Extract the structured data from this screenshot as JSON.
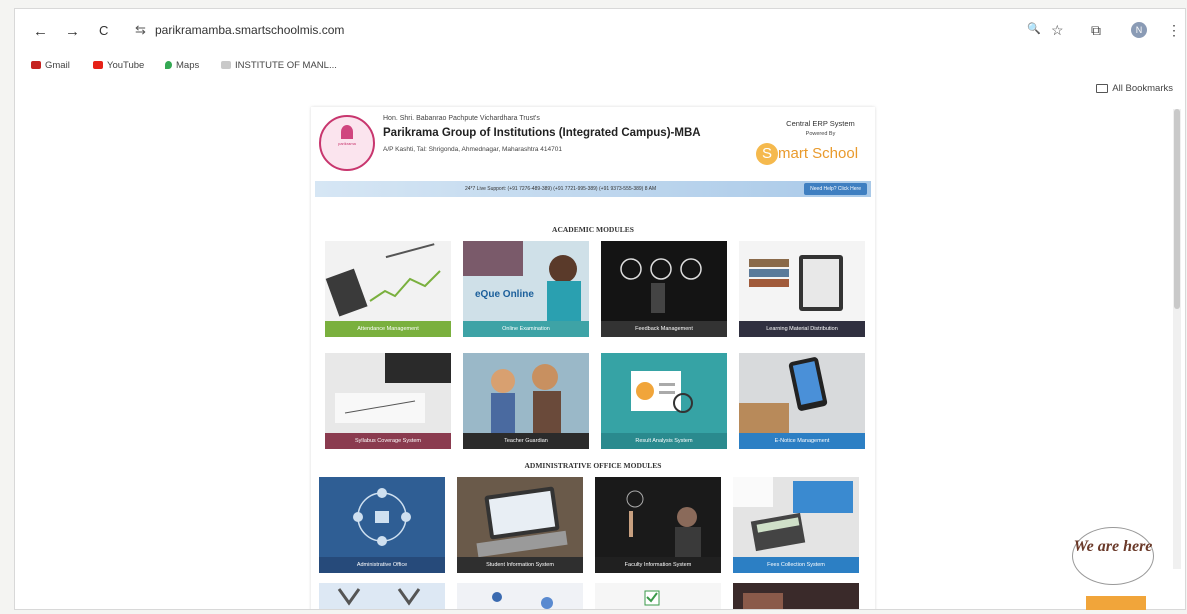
{
  "browser": {
    "url": "parikramamba.smartschoolmis.com",
    "nav_back": "←",
    "nav_forward": "→",
    "nav_reload": "C",
    "site_info": "⇆",
    "zoom_icon": "🔍",
    "star_icon": "☆",
    "extensions_icon": "⧉",
    "profile_letter": "N",
    "menu_icon": "⋮",
    "bookmarks": [
      {
        "label": "Gmail",
        "color": "#c5221f"
      },
      {
        "label": "YouTube",
        "color": "#e62117"
      },
      {
        "label": "Maps",
        "color": "#34a853"
      },
      {
        "label": "INSTITUTE OF MANL...",
        "color": "#9a9a9a"
      }
    ],
    "all_bookmarks": "All Bookmarks"
  },
  "header": {
    "trust": "Hon. Shri. Babanrao Pachpute Vichardhara Trust's",
    "institution": "Parikrama Group of Institutions (Integrated Campus)-MBA",
    "address": "A/P Kashti, Tal: Shrigonda, Ahmednagar, Maharashtra 414701",
    "erp_title": "Central ERP System",
    "powered_by": "Powered By",
    "brand_letter": "S",
    "brand_rest": "mart School",
    "logo_text": "parikrama"
  },
  "support": {
    "text": "24*7 Live Support: (+91 7276-489-389) (+91 7721-995-389) (+91 9373-555-389) 8 AM",
    "button": "Need Help? Click Here"
  },
  "sections": {
    "academic": "ACADEMIC MODULES",
    "administrative": "ADMINISTRATIVE OFFICE MODULES"
  },
  "academic_tiles": [
    {
      "caption": "Attendance Management",
      "color": "#7ab03e"
    },
    {
      "caption": "Online Examination",
      "color": "#3ea3a6"
    },
    {
      "caption": "Feedback Management",
      "color": "#333333"
    },
    {
      "caption": "Learning Material Distribution",
      "color": "#303040"
    },
    {
      "caption": "Syllabus Coverage System",
      "color": "#8a3b4f"
    },
    {
      "caption": "Teacher Guardian",
      "color": "#2b2b2b"
    },
    {
      "caption": "Result Analysis System",
      "color": "#2a8a8e"
    },
    {
      "caption": "E-Notice Management",
      "color": "#2c7fc4"
    }
  ],
  "admin_tiles": [
    {
      "caption": "Administrative Office",
      "color": "#264a7a"
    },
    {
      "caption": "Student Information System",
      "color": "#2f2f2f"
    },
    {
      "caption": "Faculty Information System",
      "color": "#202020"
    },
    {
      "caption": "Fees Collection System",
      "color": "#2c7fc4"
    }
  ],
  "tile_overlay_text": "eQue Online",
  "widget": {
    "label": "We are here"
  }
}
